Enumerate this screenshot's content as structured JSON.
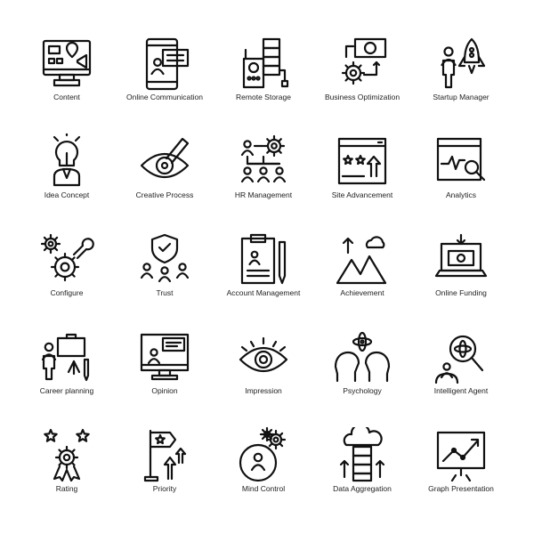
{
  "colors": {
    "stroke": "#111111",
    "background": "#ffffff"
  },
  "icons": [
    {
      "label": "Content",
      "icon": "monitor-content-icon"
    },
    {
      "label": "Online Communication",
      "icon": "tablet-chat-icon"
    },
    {
      "label": "Remote Storage",
      "icon": "server-remote-icon"
    },
    {
      "label": "Business Optimization",
      "icon": "money-gear-icon"
    },
    {
      "label": "Startup Manager",
      "icon": "person-rocket-icon"
    },
    {
      "label": "Idea Concept",
      "icon": "lightbulb-person-icon"
    },
    {
      "label": "Creative Process",
      "icon": "eye-pencil-icon"
    },
    {
      "label": "HR Management",
      "icon": "org-chart-gear-icon"
    },
    {
      "label": "Site Advancement",
      "icon": "browser-stars-icon"
    },
    {
      "label": "Analytics",
      "icon": "browser-magnifier-icon"
    },
    {
      "label": "Configure",
      "icon": "gears-wrench-icon"
    },
    {
      "label": "Trust",
      "icon": "shield-team-icon"
    },
    {
      "label": "Account Management",
      "icon": "clipboard-pen-icon"
    },
    {
      "label": "Achievement",
      "icon": "mountain-cloud-icon"
    },
    {
      "label": "Online Funding",
      "icon": "laptop-money-icon"
    },
    {
      "label": "Career planning",
      "icon": "briefcase-person-icon"
    },
    {
      "label": "Opinion",
      "icon": "monitor-speech-icon"
    },
    {
      "label": "Impression",
      "icon": "eye-icon"
    },
    {
      "label": "Psychology",
      "icon": "heads-atom-icon"
    },
    {
      "label": "Intelligent Agent",
      "icon": "person-atom-search-icon"
    },
    {
      "label": "Rating",
      "icon": "stars-badge-icon"
    },
    {
      "label": "Priority",
      "icon": "flag-arrows-icon"
    },
    {
      "label": "Mind Control",
      "icon": "head-gears-icon"
    },
    {
      "label": "Data Aggregation",
      "icon": "cloud-server-icon"
    },
    {
      "label": "Graph Presentation",
      "icon": "board-graph-icon"
    }
  ]
}
